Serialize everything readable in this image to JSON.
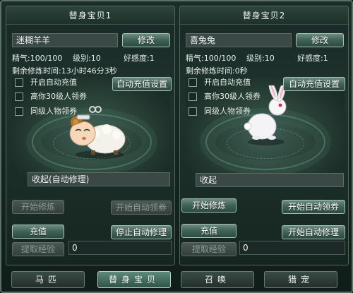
{
  "left_panel": {
    "title": "替身宝贝1",
    "name": "迷糊羊羊",
    "rename_label": "修改",
    "stats": {
      "energy": "精气:100/100",
      "level": "级别:10",
      "affinity": "好感度:1"
    },
    "remaining": "剩余修炼时间:13小时46分3秒",
    "auto_recharge_setting_label": "自动充值设置",
    "checkboxes": [
      "开启自动充值",
      "高你30级人领券",
      "同级人物领券"
    ],
    "status": "收起(自动修理)",
    "start_train_label": "开始修炼",
    "start_auto_coupon_label": "开始自动领券",
    "recharge_label": "充值",
    "stop_auto_repair_label": "停止自动修理",
    "extract_exp_label": "提取经验",
    "exp_value": "0"
  },
  "right_panel": {
    "title": "替身宝贝2",
    "name": "喜兔兔",
    "rename_label": "修改",
    "stats": {
      "energy": "精气:100/100",
      "level": "级别:10",
      "affinity": "好感度:1"
    },
    "remaining": "剩余修炼时间:0秒",
    "auto_recharge_setting_label": "自动充值设置",
    "checkboxes": [
      "开启自动充值",
      "高你30级人领券",
      "同级人物领券"
    ],
    "status": "收起",
    "start_train_label": "开始修炼",
    "start_auto_coupon_label": "开始自动领券",
    "recharge_label": "充值",
    "start_auto_repair_label": "开始自动修理",
    "extract_exp_label": "提取经验",
    "exp_value": "0"
  },
  "tabs": [
    "马匹",
    "替身宝贝",
    "召唤",
    "猎宠"
  ],
  "active_tab": "替身宝贝"
}
